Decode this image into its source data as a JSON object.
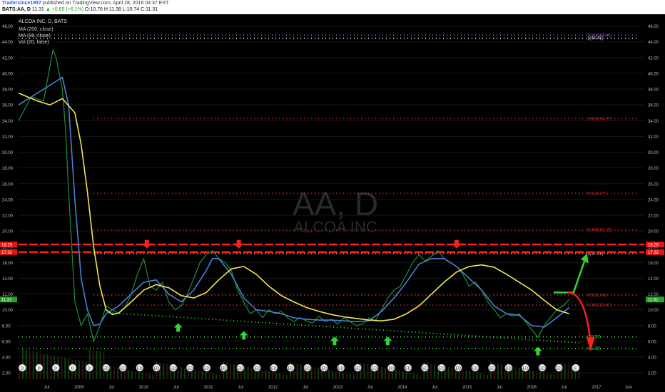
{
  "header": {
    "author": "Tradersince1997",
    "published": "published on TradingView.com, April 28, 2016 04:37 EST",
    "symbol": "BATS:AA, D",
    "quote_pre": "11.31",
    "quote_change": "▲ +0.65 (+6.1%)",
    "quote_ohlc": "O:10.76 H:11.38 L:10.74 C:11.31"
  },
  "chart_data": {
    "type": "line",
    "title": "ALCOA INC, D, BATS",
    "indicators": [
      "MA (200, close)",
      "MA (38, close)",
      "Vol (20, false)"
    ],
    "watermark": {
      "symbol": "AA, D",
      "name": "ALCOA INC"
    },
    "ylim": [
      1.2,
      47.5
    ],
    "y_ticks": [
      2,
      4,
      6,
      8,
      10,
      12,
      14,
      16,
      18,
      20,
      22,
      24,
      26,
      28,
      30,
      32,
      34,
      36,
      38,
      40,
      42,
      44,
      46
    ],
    "x_labels": [
      "Jul",
      "2009",
      "Jul",
      "2010",
      "Jul",
      "2011",
      "Jul",
      "2012",
      "Jul",
      "2013",
      "Jul",
      "2014",
      "Jul",
      "2015",
      "Jul",
      "2016",
      "Jul",
      "2017",
      "Jun"
    ],
    "price_badges": [
      {
        "value": "18.29",
        "color": "#e81414"
      },
      {
        "value": "17.32",
        "color": "#e81414"
      },
      {
        "value": "11.31",
        "color": "#1ea81e"
      }
    ],
    "series": [
      {
        "name": "Price",
        "color": "#1e8f3a",
        "values": [
          [
            0.0,
            34.0
          ],
          [
            0.02,
            37.0
          ],
          [
            0.04,
            36.5
          ],
          [
            0.055,
            43.0
          ],
          [
            0.06,
            42.0
          ],
          [
            0.07,
            38.0
          ],
          [
            0.075,
            33.0
          ],
          [
            0.08,
            25.0
          ],
          [
            0.085,
            18.0
          ],
          [
            0.09,
            11.0
          ],
          [
            0.1,
            8.0
          ],
          [
            0.11,
            9.5
          ],
          [
            0.12,
            6.0
          ],
          [
            0.13,
            8.0
          ],
          [
            0.14,
            10.5
          ],
          [
            0.15,
            10.0
          ],
          [
            0.16,
            9.5
          ],
          [
            0.17,
            10.3
          ],
          [
            0.18,
            12.0
          ],
          [
            0.19,
            14.5
          ],
          [
            0.2,
            16.5
          ],
          [
            0.21,
            13.0
          ],
          [
            0.22,
            12.5
          ],
          [
            0.23,
            13.5
          ],
          [
            0.24,
            11.0
          ],
          [
            0.25,
            10.0
          ],
          [
            0.26,
            10.5
          ],
          [
            0.27,
            12.0
          ],
          [
            0.28,
            14.0
          ],
          [
            0.29,
            16.0
          ],
          [
            0.3,
            17.0
          ],
          [
            0.31,
            17.5
          ],
          [
            0.32,
            16.5
          ],
          [
            0.33,
            16.0
          ],
          [
            0.34,
            15.0
          ],
          [
            0.35,
            12.5
          ],
          [
            0.36,
            11.0
          ],
          [
            0.37,
            9.5
          ],
          [
            0.38,
            10.0
          ],
          [
            0.39,
            9.0
          ],
          [
            0.4,
            10.0
          ],
          [
            0.41,
            9.5
          ],
          [
            0.42,
            9.8
          ],
          [
            0.43,
            9.0
          ],
          [
            0.44,
            8.5
          ],
          [
            0.45,
            9.0
          ],
          [
            0.46,
            8.6
          ],
          [
            0.47,
            8.3
          ],
          [
            0.48,
            9.2
          ],
          [
            0.49,
            8.5
          ],
          [
            0.5,
            8.8
          ],
          [
            0.51,
            8.2
          ],
          [
            0.52,
            9.0
          ],
          [
            0.53,
            8.5
          ],
          [
            0.54,
            8.0
          ],
          [
            0.55,
            8.2
          ],
          [
            0.56,
            9.0
          ],
          [
            0.57,
            8.6
          ],
          [
            0.58,
            10.0
          ],
          [
            0.59,
            11.5
          ],
          [
            0.6,
            12.5
          ],
          [
            0.61,
            13.0
          ],
          [
            0.62,
            14.5
          ],
          [
            0.63,
            16.0
          ],
          [
            0.64,
            17.0
          ],
          [
            0.65,
            16.2
          ],
          [
            0.66,
            16.8
          ],
          [
            0.67,
            17.5
          ],
          [
            0.68,
            16.5
          ],
          [
            0.69,
            16.0
          ],
          [
            0.7,
            15.5
          ],
          [
            0.71,
            14.5
          ],
          [
            0.72,
            13.0
          ],
          [
            0.73,
            13.5
          ],
          [
            0.74,
            12.5
          ],
          [
            0.75,
            11.0
          ],
          [
            0.76,
            10.0
          ],
          [
            0.77,
            9.0
          ],
          [
            0.78,
            9.5
          ],
          [
            0.79,
            9.2
          ],
          [
            0.8,
            9.5
          ],
          [
            0.81,
            8.5
          ],
          [
            0.82,
            7.5
          ],
          [
            0.83,
            6.5
          ],
          [
            0.84,
            8.0
          ],
          [
            0.85,
            9.0
          ],
          [
            0.86,
            10.0
          ],
          [
            0.87,
            10.5
          ],
          [
            0.88,
            11.3
          ]
        ]
      },
      {
        "name": "MA (38, close)",
        "color": "#4a7fd6",
        "values": [
          [
            0.0,
            36.0
          ],
          [
            0.03,
            37.5
          ],
          [
            0.06,
            39.0
          ],
          [
            0.07,
            39.5
          ],
          [
            0.08,
            36.0
          ],
          [
            0.09,
            24.0
          ],
          [
            0.1,
            14.0
          ],
          [
            0.11,
            10.0
          ],
          [
            0.12,
            8.0
          ],
          [
            0.13,
            8.2
          ],
          [
            0.14,
            9.5
          ],
          [
            0.15,
            10.0
          ],
          [
            0.16,
            10.5
          ],
          [
            0.18,
            12.0
          ],
          [
            0.2,
            13.5
          ],
          [
            0.22,
            13.8
          ],
          [
            0.24,
            12.0
          ],
          [
            0.26,
            11.0
          ],
          [
            0.28,
            12.5
          ],
          [
            0.3,
            15.0
          ],
          [
            0.31,
            16.5
          ],
          [
            0.32,
            16.5
          ],
          [
            0.34,
            14.5
          ],
          [
            0.36,
            11.5
          ],
          [
            0.38,
            10.0
          ],
          [
            0.4,
            9.8
          ],
          [
            0.42,
            9.5
          ],
          [
            0.44,
            9.0
          ],
          [
            0.46,
            8.8
          ],
          [
            0.48,
            8.7
          ],
          [
            0.5,
            8.7
          ],
          [
            0.52,
            8.6
          ],
          [
            0.54,
            8.5
          ],
          [
            0.56,
            8.6
          ],
          [
            0.58,
            9.8
          ],
          [
            0.6,
            11.5
          ],
          [
            0.62,
            13.5
          ],
          [
            0.64,
            15.8
          ],
          [
            0.66,
            16.5
          ],
          [
            0.68,
            16.5
          ],
          [
            0.7,
            15.5
          ],
          [
            0.72,
            14.0
          ],
          [
            0.74,
            12.5
          ],
          [
            0.76,
            10.5
          ],
          [
            0.78,
            9.5
          ],
          [
            0.8,
            9.3
          ],
          [
            0.82,
            8.0
          ],
          [
            0.84,
            7.8
          ],
          [
            0.86,
            9.0
          ],
          [
            0.88,
            10.3
          ]
        ]
      },
      {
        "name": "MA (200, close)",
        "color": "#f2e64f",
        "values": [
          [
            0.0,
            37.5
          ],
          [
            0.03,
            36.5
          ],
          [
            0.05,
            36.0
          ],
          [
            0.07,
            36.8
          ],
          [
            0.09,
            35.0
          ],
          [
            0.1,
            31.0
          ],
          [
            0.11,
            25.0
          ],
          [
            0.12,
            18.0
          ],
          [
            0.13,
            13.0
          ],
          [
            0.14,
            10.0
          ],
          [
            0.15,
            9.4
          ],
          [
            0.16,
            9.6
          ],
          [
            0.18,
            11.0
          ],
          [
            0.2,
            12.5
          ],
          [
            0.22,
            13.2
          ],
          [
            0.24,
            12.8
          ],
          [
            0.26,
            11.8
          ],
          [
            0.28,
            11.5
          ],
          [
            0.3,
            12.2
          ],
          [
            0.32,
            13.8
          ],
          [
            0.34,
            15.2
          ],
          [
            0.36,
            15.5
          ],
          [
            0.38,
            14.5
          ],
          [
            0.4,
            13.0
          ],
          [
            0.42,
            11.8
          ],
          [
            0.44,
            11.0
          ],
          [
            0.46,
            10.3
          ],
          [
            0.48,
            9.8
          ],
          [
            0.5,
            9.4
          ],
          [
            0.52,
            9.1
          ],
          [
            0.54,
            8.9
          ],
          [
            0.56,
            8.7
          ],
          [
            0.58,
            8.6
          ],
          [
            0.6,
            8.8
          ],
          [
            0.62,
            9.5
          ],
          [
            0.64,
            10.5
          ],
          [
            0.66,
            12.0
          ],
          [
            0.68,
            13.5
          ],
          [
            0.7,
            14.8
          ],
          [
            0.72,
            15.5
          ],
          [
            0.74,
            15.7
          ],
          [
            0.76,
            15.4
          ],
          [
            0.78,
            14.5
          ],
          [
            0.8,
            13.5
          ],
          [
            0.82,
            12.5
          ],
          [
            0.84,
            11.2
          ],
          [
            0.86,
            10.0
          ],
          [
            0.88,
            9.5
          ]
        ]
      }
    ],
    "fibonacci": [
      {
        "label": "1.618(44.85)",
        "value": 44.85,
        "color": "#8d4fc4"
      },
      {
        "label": "1(44.45)",
        "value": 44.45,
        "color": "#cccccc"
      },
      {
        "label": "2.618(34.27)",
        "value": 34.27,
        "color": "#d42b2b"
      },
      {
        "label": "0.5(24.77)",
        "value": 24.77,
        "color": "#d42b2b"
      },
      {
        "label": "0.386(20.13)",
        "value": 20.13,
        "color": "#d42b2b"
      },
      {
        "label": "1(17.15)",
        "value": 17.15,
        "color": "#cccccc"
      },
      {
        "label": "0.5(11.86)",
        "value": 11.86,
        "color": "#d42b2b"
      },
      {
        "label": "0.382(10.61)",
        "value": 10.61,
        "color": "#d42b2b"
      },
      {
        "label": "0(6.57)",
        "value": 6.57,
        "color": "#35d335"
      },
      {
        "label": "0(5.09)",
        "value": 5.09,
        "color": "#35d335"
      }
    ],
    "resistance": [
      18.29,
      17.32
    ],
    "event_badges": [
      "D",
      "D",
      "D",
      "D",
      "D",
      "ED",
      "ED",
      "ED",
      "ED",
      "ED",
      "ED",
      "ED",
      "ED",
      "ED",
      "ED",
      "ED",
      "ED",
      "ED",
      "ED",
      "ED",
      "ED",
      "ED",
      "ED",
      "ED",
      "ED",
      "ED",
      "ED",
      "ED",
      "ED",
      "ED",
      "ED",
      "ED",
      "ED",
      "E"
    ]
  }
}
